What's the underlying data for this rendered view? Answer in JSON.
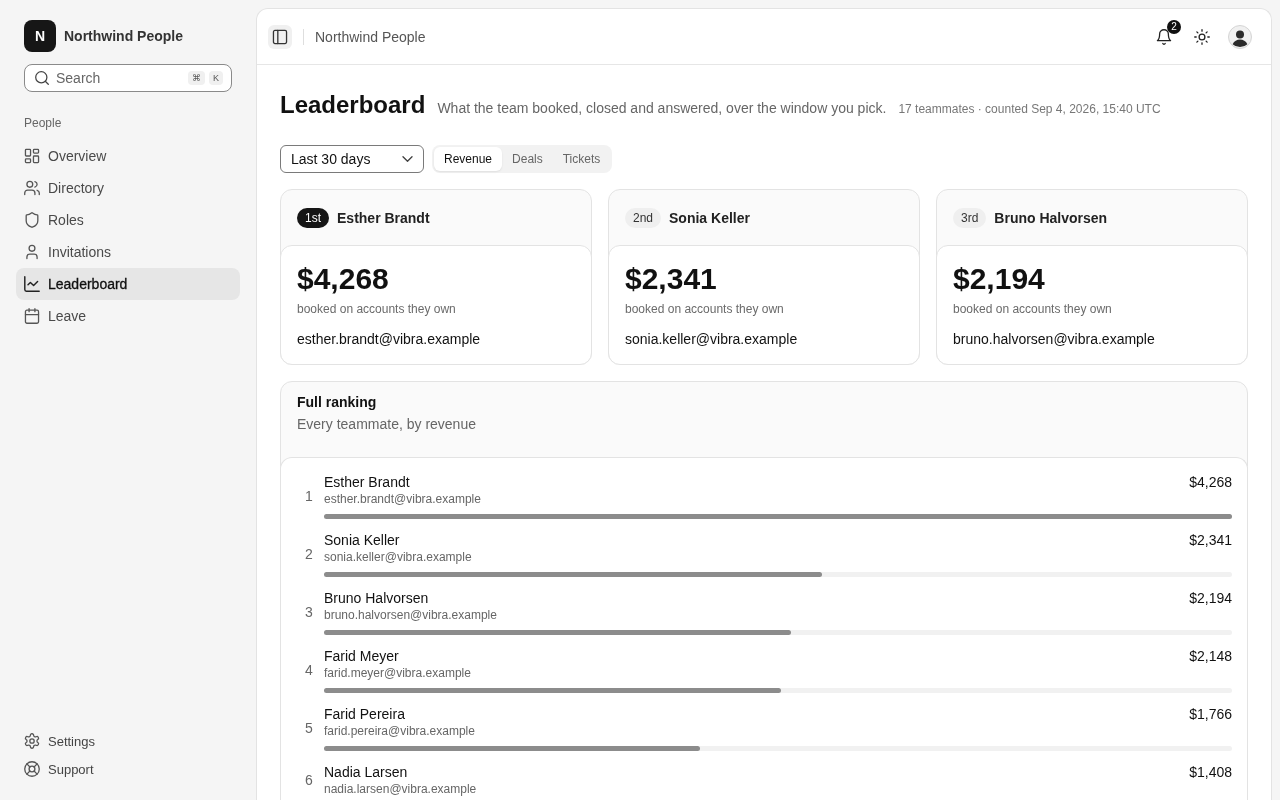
{
  "sidebar": {
    "brand": {
      "initial": "N",
      "name": "Northwind People"
    },
    "search": {
      "placeholder": "Search",
      "keys": [
        "⌘",
        "K"
      ]
    },
    "section": "People",
    "items": [
      {
        "label": "Overview",
        "selected": false
      },
      {
        "label": "Directory",
        "selected": false
      },
      {
        "label": "Roles",
        "selected": false
      },
      {
        "label": "Invitations",
        "selected": false
      },
      {
        "label": "Leaderboard",
        "selected": true
      },
      {
        "label": "Leave",
        "selected": false
      }
    ],
    "footer": [
      {
        "label": "Settings"
      },
      {
        "label": "Support"
      }
    ]
  },
  "topbar": {
    "breadcrumb": "Northwind People",
    "notifications": "2"
  },
  "header": {
    "title": "Leaderboard",
    "description": "What the team booked, closed and answered, over the window you pick.",
    "meta": "17 teammates · counted Sep 4, 2026, 15:40 UTC"
  },
  "filters": {
    "period": "Last 30 days",
    "tabs": [
      {
        "label": "Revenue",
        "selected": true
      },
      {
        "label": "Deals",
        "selected": false
      },
      {
        "label": "Tickets",
        "selected": false
      }
    ]
  },
  "podium": [
    {
      "place": "1st",
      "highlighted": true,
      "name": "Esther Brandt",
      "amount": "$4,268",
      "caption": "booked on accounts they own",
      "email": "esther.brandt@vibra.example"
    },
    {
      "place": "2nd",
      "highlighted": false,
      "name": "Sonia Keller",
      "amount": "$2,341",
      "caption": "booked on accounts they own",
      "email": "sonia.keller@vibra.example"
    },
    {
      "place": "3rd",
      "highlighted": false,
      "name": "Bruno Halvorsen",
      "amount": "$2,194",
      "caption": "booked on accounts they own",
      "email": "bruno.halvorsen@vibra.example"
    }
  ],
  "ranking": {
    "title": "Full ranking",
    "subtitle": "Every teammate, by revenue",
    "rows": [
      {
        "rank": "1",
        "name": "Esther Brandt",
        "email": "esther.brandt@vibra.example",
        "amount": "$4,268",
        "level": 1.0
      },
      {
        "rank": "2",
        "name": "Sonia Keller",
        "email": "sonia.keller@vibra.example",
        "amount": "$2,341",
        "level": 0.549
      },
      {
        "rank": "3",
        "name": "Bruno Halvorsen",
        "email": "bruno.halvorsen@vibra.example",
        "amount": "$2,194",
        "level": 0.514
      },
      {
        "rank": "4",
        "name": "Farid Meyer",
        "email": "farid.meyer@vibra.example",
        "amount": "$2,148",
        "level": 0.503
      },
      {
        "rank": "5",
        "name": "Farid Pereira",
        "email": "farid.pereira@vibra.example",
        "amount": "$1,766",
        "level": 0.414
      },
      {
        "rank": "6",
        "name": "Nadia Larsen",
        "email": "nadia.larsen@vibra.example",
        "amount": "$1,408"
      }
    ]
  }
}
